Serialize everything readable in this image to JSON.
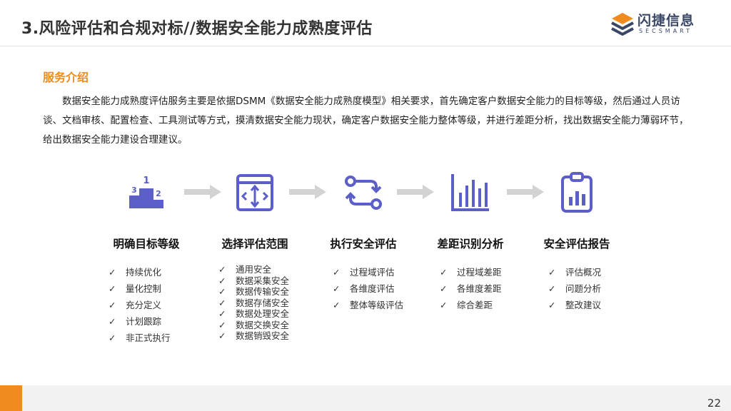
{
  "header": {
    "title": "3.风险评估和合规对标//数据安全能力成熟度评估",
    "logo_name": "闪捷信息",
    "logo_sub": "SECSMART"
  },
  "section": {
    "title": "服务介绍",
    "intro": "数据安全能力成熟度评估服务主要是依据DSMM《数据安全能力成熟度模型》相关要求，首先确定客户数据安全能力的目标等级，然后通过人员访谈、文档审核、配置检查、工具测试等方式，摸清数据安全能力现状，确定客户数据安全能力整体等级，并进行差距分析，找出数据安全能力薄弱环节，给出数据安全能力建设合理建议。"
  },
  "colors": {
    "accent": "#f08c1e",
    "icon": "#5b5fc7",
    "arrow": "#d3d3d3"
  },
  "steps": [
    {
      "icon": "podium-icon",
      "name": "明确目标等级",
      "items": [
        "持续优化",
        "量化控制",
        "充分定义",
        "计划跟踪",
        "非正式执行"
      ]
    },
    {
      "icon": "scope-window-icon",
      "name": "选择评估范围",
      "items": [
        "通用安全",
        "数据采集安全",
        "数据传输安全",
        "数据存储安全",
        "数据处理安全",
        "数据交换安全",
        "数据销毁安全"
      ]
    },
    {
      "icon": "flow-cycle-icon",
      "name": "执行安全评估",
      "items": [
        "过程域评估",
        "各维度评估",
        "整体等级评估"
      ]
    },
    {
      "icon": "bar-chart-icon",
      "name": "差距识别分析",
      "items": [
        "过程域差距",
        "各维度差距",
        "综合差距"
      ]
    },
    {
      "icon": "clipboard-chart-icon",
      "name": "安全评估报告",
      "items": [
        "评估概况",
        "问题分析",
        "整改建议"
      ]
    }
  ],
  "check_mark": "✓",
  "footer": {
    "page_number": "22"
  }
}
